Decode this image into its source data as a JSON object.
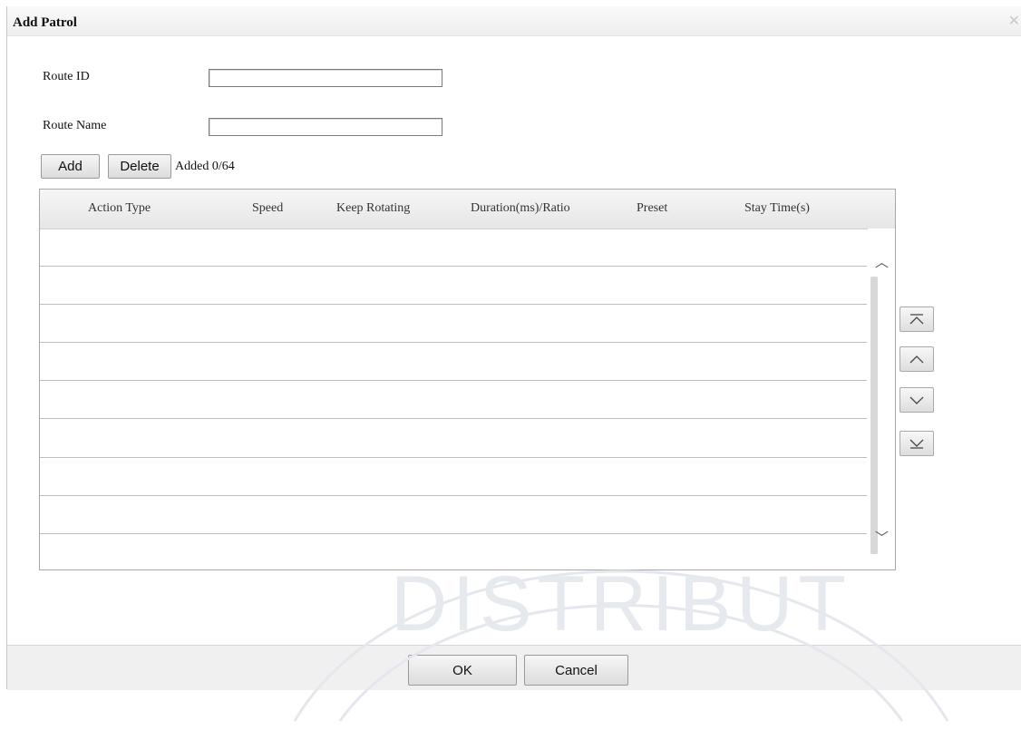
{
  "dialog": {
    "title": "Add Patrol",
    "close_icon": "close-icon"
  },
  "form": {
    "route_id_label": "Route ID",
    "route_id_value": "",
    "route_name_label": "Route Name",
    "route_name_value": ""
  },
  "toolbar": {
    "add_label": "Add",
    "delete_label": "Delete",
    "added_status": "Added 0/64"
  },
  "table": {
    "columns": [
      "Action Type",
      "Speed",
      "Keep Rotating",
      "Duration(ms)/Ratio",
      "Preset",
      "Stay Time(s)"
    ],
    "rows": []
  },
  "side_buttons": [
    "move-top-icon",
    "move-up-icon",
    "move-down-icon",
    "move-bottom-icon"
  ],
  "footer": {
    "ok_label": "OK",
    "cancel_label": "Cancel"
  },
  "watermark": {
    "text": "DISTRIBUT"
  }
}
